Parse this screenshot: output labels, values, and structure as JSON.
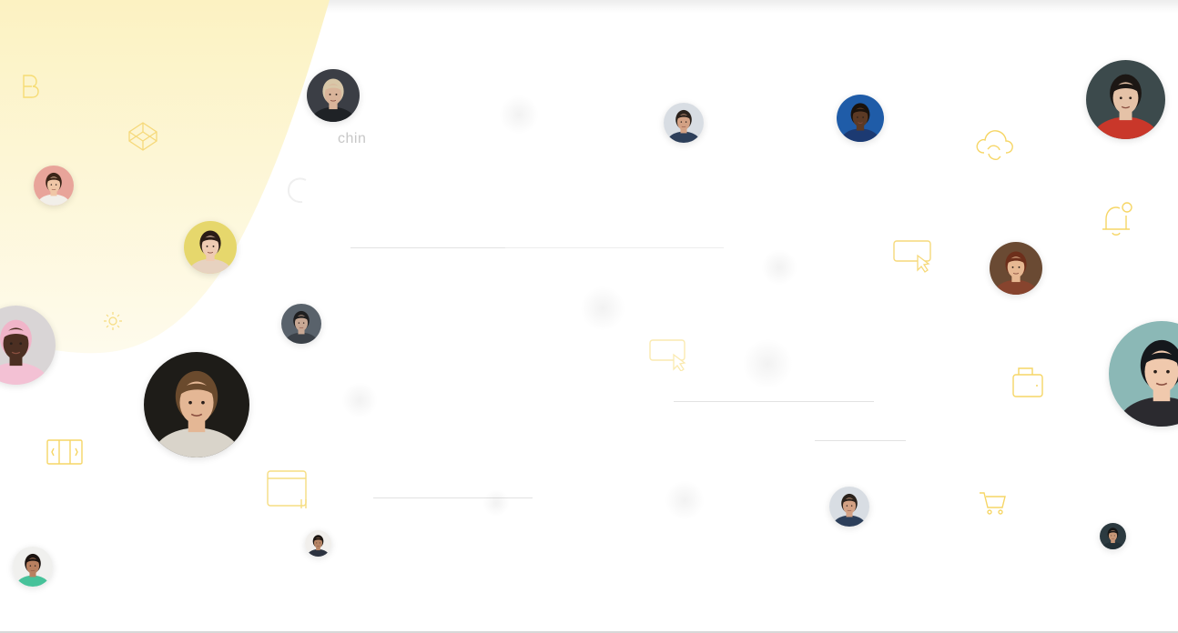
{
  "brand": {
    "accent_yellow": "#f6d44a",
    "blob_yellow": "#fdf6cf"
  },
  "faint_texts": {
    "name_partial": "chin"
  },
  "avatars": [
    {
      "id": "woman-blonde",
      "bg": "#3b3e45",
      "skin": "#d9b49a",
      "hair": "#d8c7a8",
      "shirt": "#1f2226"
    },
    {
      "id": "man-dark-hair",
      "bg": "#d8dde3",
      "skin": "#d3a184",
      "hair": "#2a211b",
      "shirt": "#2d3f5a"
    },
    {
      "id": "man-blue-bg",
      "bg": "#1f5ca8",
      "skin": "#5c3a25",
      "hair": "#1a120c",
      "shirt": "#1c3a72"
    },
    {
      "id": "woman-red-sweater",
      "bg": "#3c4a4c",
      "skin": "#e5c2a7",
      "hair": "#1c1714",
      "shirt": "#c9372a"
    },
    {
      "id": "man-pink-bg",
      "bg": "#e8a49a",
      "skin": "#f0c6a6",
      "hair": "#3b2418",
      "shirt": "#f2efe9"
    },
    {
      "id": "woman-yellow-bg",
      "bg": "#e6d76c",
      "skin": "#efcbb3",
      "hair": "#2a1c16",
      "shirt": "#e7d2c0"
    },
    {
      "id": "woman-hat",
      "bg": "#6a4a33",
      "skin": "#e7b892",
      "hair": "#6d2f1b",
      "shirt": "#87442e"
    },
    {
      "id": "woman-pink-scarf",
      "bg": "#d9d5d6",
      "skin": "#4c2f22",
      "hair": "#f0b5c9",
      "shirt": "#f3c1d4"
    },
    {
      "id": "man-grey-shirt",
      "bg": "#59626b",
      "skin": "#c8a894",
      "hair": "#1e1e1f",
      "shirt": "#3b4148"
    },
    {
      "id": "boy-large",
      "bg": "#1e1c18",
      "skin": "#e4b795",
      "hair": "#6a4a2d",
      "shirt": "#d9d4ca"
    },
    {
      "id": "woman-black-hat",
      "bg": "#8bb8b6",
      "skin": "#f0c9ad",
      "hair": "#15181c",
      "shirt": "#2b2a2f"
    },
    {
      "id": "man-green-shirt",
      "bg": "#f0f0ee",
      "skin": "#b98060",
      "hair": "#1b1310",
      "shirt": "#47c29a"
    },
    {
      "id": "man-beard-small",
      "bg": "#f1efec",
      "skin": "#b68464",
      "hair": "#1a1410",
      "shirt": "#2c3340"
    },
    {
      "id": "man-dark-hair-2",
      "bg": "#d8dde3",
      "skin": "#d3a184",
      "hair": "#2a211b",
      "shirt": "#2d3f5a"
    },
    {
      "id": "man-smoke",
      "bg": "#2c3a40",
      "skin": "#c89878",
      "hair": "#161616",
      "shirt": "#233036"
    }
  ],
  "icons": [
    "bootstrap-icon",
    "codepen-icon",
    "cloud-sync-icon",
    "bell-notification-icon",
    "monitor-cursor-icon",
    "sun-icon",
    "columns-icon",
    "browser-window-icon",
    "wallet-icon",
    "shopping-cart-icon",
    "monitor-cursor-icon",
    "loader-icon"
  ]
}
